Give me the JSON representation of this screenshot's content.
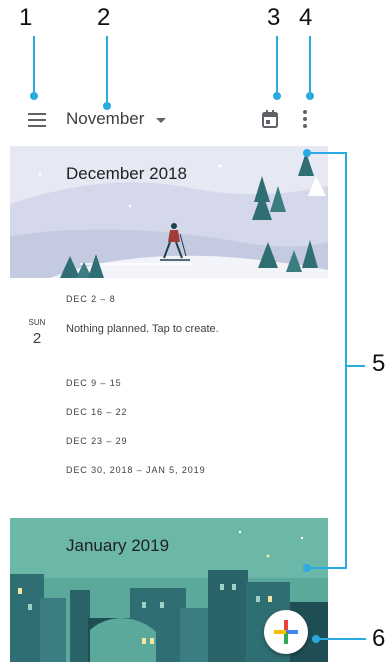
{
  "callouts": [
    "1",
    "2",
    "3",
    "4",
    "5",
    "6"
  ],
  "appbar": {
    "month": "November"
  },
  "december": {
    "title": "December 2018",
    "weeks": [
      "DEC 2 – 8",
      "DEC 9 – 15",
      "DEC 16 – 22",
      "DEC 23 – 29",
      "DEC 30, 2018 – JAN 5, 2019"
    ],
    "day": {
      "dow": "SUN",
      "num": "2",
      "empty_text": "Nothing planned. Tap to create."
    }
  },
  "january": {
    "title": "January 2019"
  },
  "colors": {
    "accent": "#29abe2",
    "winter_sky": "#dfe3f0",
    "pine": "#2f6f73",
    "january_teal": "#5aa99a"
  },
  "icons": {
    "menu": "menu-icon",
    "dropdown": "caret-down-icon",
    "today": "calendar-today-icon",
    "more": "more-vert-icon",
    "create": "plus-icon"
  }
}
